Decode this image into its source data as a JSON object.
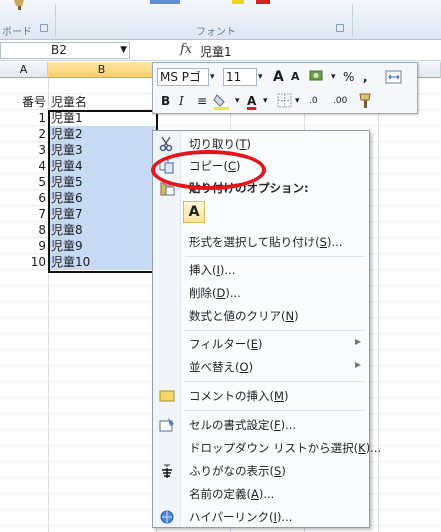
{
  "ribbon": {
    "clipboard_group_label": "ボード",
    "font_group_label": "フォント"
  },
  "formula_bar": {
    "name_box": "B2",
    "fx_label": "fx",
    "content": "児童1"
  },
  "columns": [
    "A",
    "B"
  ],
  "rows": [
    {
      "a": "番号",
      "b": "児童名"
    },
    {
      "a": "1",
      "b": "児童1"
    },
    {
      "a": "2",
      "b": "児童2"
    },
    {
      "a": "3",
      "b": "児童3"
    },
    {
      "a": "4",
      "b": "児童4"
    },
    {
      "a": "5",
      "b": "児童5"
    },
    {
      "a": "6",
      "b": "児童6"
    },
    {
      "a": "7",
      "b": "児童7"
    },
    {
      "a": "8",
      "b": "児童8"
    },
    {
      "a": "9",
      "b": "児童9"
    },
    {
      "a": "10",
      "b": "児童10"
    }
  ],
  "mini_toolbar": {
    "font_name": "MS Pゴ",
    "font_size": "11",
    "grow": "A",
    "shrink": "A",
    "percent": "%",
    "comma": ",",
    "bold": "B",
    "italic": "I",
    "align": "≡",
    "font_color": "A",
    "dec_inc": ".0",
    "dec_dec": ".00"
  },
  "context_menu": {
    "cut": {
      "text": "切り取り(",
      "acc": "T",
      "end": ")"
    },
    "copy": {
      "text": "コピー(",
      "acc": "C",
      "end": ")"
    },
    "paste_options": "貼り付けのオプション:",
    "paste_button": "A",
    "paste_special": {
      "text": "形式を選択して貼り付け(",
      "acc": "S",
      "end": ")..."
    },
    "insert": {
      "text": "挿入(",
      "acc": "I",
      "end": ")..."
    },
    "delete": {
      "text": "削除(",
      "acc": "D",
      "end": ")..."
    },
    "clear": {
      "text": "数式と値のクリア(",
      "acc": "N",
      "end": ")"
    },
    "filter": {
      "text": "フィルター(",
      "acc": "E",
      "end": ")"
    },
    "sort": {
      "text": "並べ替え(",
      "acc": "O",
      "end": ")"
    },
    "insert_comment": {
      "text": "コメントの挿入(",
      "acc": "M",
      "end": ")"
    },
    "format_cells": {
      "text": "セルの書式設定(",
      "acc": "F",
      "end": ")..."
    },
    "dropdown": {
      "text": "ドロップダウン リストから選択(",
      "acc": "K",
      "end": ")..."
    },
    "phonetic": {
      "text": "ふりがなの表示(",
      "acc": "S",
      "end": ")"
    },
    "define_name": {
      "text": "名前の定義(",
      "acc": "A",
      "end": ")..."
    },
    "hyperlink": {
      "text": "ハイパーリンク(",
      "acc": "I",
      "end": ")..."
    }
  },
  "colors": {
    "highlight": "#e8141c",
    "selection": "#c6daf4"
  }
}
